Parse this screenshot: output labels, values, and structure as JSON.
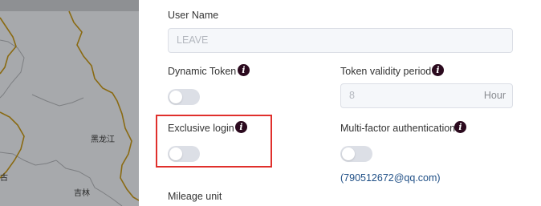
{
  "map": {
    "labels": [
      "黑龙江",
      "吉林",
      "古"
    ]
  },
  "form": {
    "user_name": {
      "label": "User Name",
      "value": "LEAVE"
    },
    "dynamic_token": {
      "label": "Dynamic Token",
      "enabled": false
    },
    "token_validity": {
      "label": "Token validity period",
      "value": "8",
      "unit": "Hour"
    },
    "exclusive_login": {
      "label": "Exclusive login",
      "enabled": false
    },
    "mfa": {
      "label": "Multi-factor authentication",
      "enabled": false,
      "email": "(790512672@qq.com)"
    },
    "mileage_unit": {
      "label": "Mileage unit"
    }
  },
  "icons": {
    "info": "i"
  },
  "colors": {
    "highlight": "#e0302c",
    "info_icon": "#2b0a1e",
    "email_link": "#1f4f86"
  }
}
